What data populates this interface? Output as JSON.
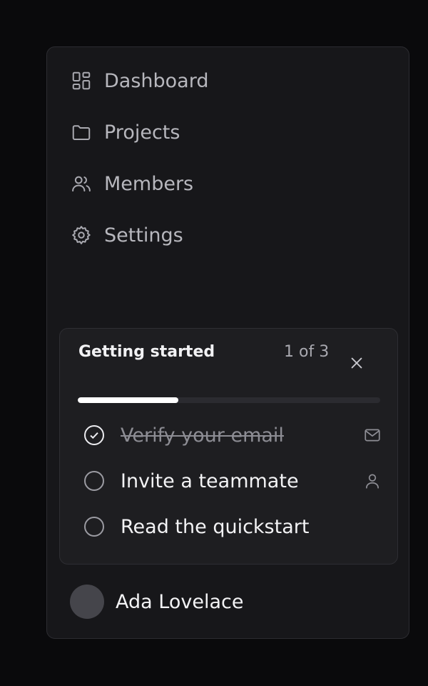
{
  "nav": {
    "items": [
      {
        "label": "Dashboard",
        "icon": "dashboard-icon"
      },
      {
        "label": "Projects",
        "icon": "folder-icon"
      },
      {
        "label": "Members",
        "icon": "users-icon"
      },
      {
        "label": "Settings",
        "icon": "gear-icon"
      }
    ]
  },
  "onboarding": {
    "title": "Getting started",
    "progress_text": "1 of 3",
    "progress_fraction": 0.333,
    "tasks": [
      {
        "label": "Verify your email",
        "done": true,
        "icon": "mail-icon"
      },
      {
        "label": "Invite a teammate",
        "done": false,
        "icon": "user-icon"
      },
      {
        "label": "Read the quickstart",
        "done": false,
        "icon": ""
      }
    ]
  },
  "user": {
    "name": "Ada Lovelace"
  },
  "colors": {
    "background": "#0a0a0c",
    "panel": "#17171a",
    "card": "#1e1e21",
    "accent": "#ffffff"
  }
}
